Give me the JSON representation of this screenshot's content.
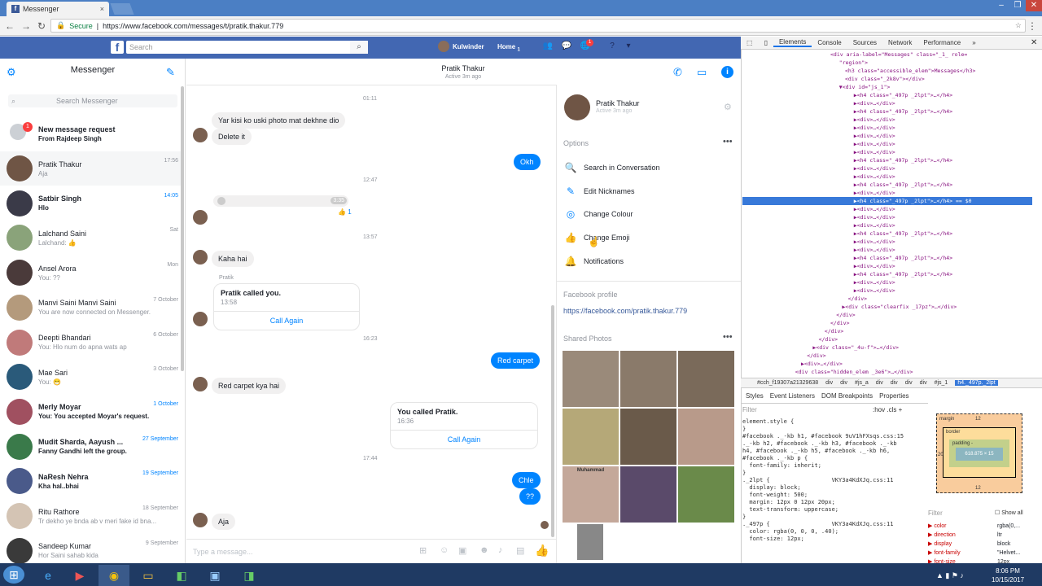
{
  "browser": {
    "tab_title": "Messenger",
    "tab_close": "×",
    "secure_label": "Secure",
    "url": "https://www.facebook.com/messages/t/pratik.thakur.779",
    "window_buttons": [
      "–",
      "❐",
      "✕"
    ]
  },
  "fb_bar": {
    "logo": "f",
    "search_placeholder": "Search",
    "user_name": "Kulwinder",
    "home_label": "Home",
    "home_count": "1",
    "notif_count": "1"
  },
  "left": {
    "title": "Messenger",
    "search_placeholder": "Search Messenger",
    "new_request": {
      "title": "New message request",
      "from": "From Rajdeep Singh",
      "badge": "1"
    },
    "conversations": [
      {
        "name": "Pratik Thakur",
        "snippet": "Aja",
        "time": "17:56",
        "unread": false,
        "active": true,
        "color": "#6f5545"
      },
      {
        "name": "Satbir Singh",
        "snippet": "Hlo",
        "time": "14:05",
        "unread": true,
        "active": false,
        "color": "#3a3a48"
      },
      {
        "name": "Lalchand Saini",
        "snippet": "Lalchand: 👍",
        "time": "Sat",
        "unread": false,
        "active": false,
        "color": "#8aa37a"
      },
      {
        "name": "Ansel Arora",
        "snippet": "You: ??",
        "time": "Mon",
        "unread": false,
        "active": false,
        "color": "#4a3a3a"
      },
      {
        "name": "Manvi Saini Manvi Saini",
        "snippet": "You are now connected on Messenger.",
        "time": "7 October",
        "unread": false,
        "active": false,
        "color": "#b49a7c"
      },
      {
        "name": "Deepti Bhandari",
        "snippet": "You: Hlo num do apna wats ap",
        "time": "6 October",
        "unread": false,
        "active": false,
        "color": "#c07a7a"
      },
      {
        "name": "Mae Sari",
        "snippet": "You: 😁",
        "time": "3 October",
        "unread": false,
        "active": false,
        "color": "#2a5a7a"
      },
      {
        "name": "Merly Moyar",
        "snippet": "You: You accepted Moyar's request.",
        "time": "1 October",
        "unread": true,
        "active": false,
        "color": "#a05060"
      },
      {
        "name": "Mudit Sharda, Aayush ...",
        "snippet": "Fanny Gandhi left the group.",
        "time": "27 September",
        "unread": true,
        "active": false,
        "color": "#3a7a4a"
      },
      {
        "name": "NaResh Nehra",
        "snippet": "Kha hal..bhai",
        "time": "19 September",
        "unread": true,
        "active": false,
        "color": "#4a5a8a"
      },
      {
        "name": "Ritu Rathore",
        "snippet": "Tr dekho ye bnda ab v meri fake id bna...",
        "time": "18 September",
        "unread": false,
        "active": false,
        "color": "#d4c4b4"
      },
      {
        "name": "Sandeep Kumar",
        "snippet": "Hor Saini sahab kida",
        "time": "9 September",
        "unread": false,
        "active": false,
        "color": "#3a3a3a"
      }
    ]
  },
  "chat": {
    "name": "Pratik Thakur",
    "status": "Active 3m ago",
    "messages": {
      "ts1": "01:11",
      "m1": "Yar kisi ko uski photo mat dekhne dio",
      "m2": "Delete it",
      "m3": "Okh",
      "ts2": "12:47",
      "audio_time": "3:35",
      "audio_likes": "1",
      "ts3": "13:57",
      "m4": "Kaha hai",
      "call_sender": "Pratik",
      "call1_title": "Pratik called you.",
      "call1_time": "13:58",
      "call_again": "Call Again",
      "ts4": "16:23",
      "m5": "Red carpet",
      "m6": "Red carpet kya hai",
      "call2_title": "You called Pratik.",
      "call2_time": "16:36",
      "ts5": "17:44",
      "m7": "Chle",
      "m8": "??",
      "m9": "Aja"
    },
    "compose_placeholder": "Type a message..."
  },
  "info": {
    "name": "Pratik Thakur",
    "status": "Active 3m ago",
    "options_label": "Options",
    "options": [
      {
        "label": "Search in Conversation",
        "icon": "🔍"
      },
      {
        "label": "Edit Nicknames",
        "icon": "✎"
      },
      {
        "label": "Change Colour",
        "icon": "◎"
      },
      {
        "label": "Change Emoji",
        "icon": "👍"
      },
      {
        "label": "Notifications",
        "icon": "🔔"
      }
    ],
    "profile_label": "Facebook profile",
    "profile_link": "https://facebook.com/pratik.thakur.779",
    "photos_label": "Shared Photos",
    "photo_caption": "Muhammad",
    "photo_colors": [
      "#9a8a7a",
      "#8a7a6a",
      "#7a6a5a",
      "#b5a878",
      "#6a5a4a",
      "#b89a8a",
      "#c4a89a",
      "#5a4a6a",
      "#6a8a4a",
      "#888888"
    ]
  },
  "devtools": {
    "tabs": [
      "Elements",
      "Console",
      "Sources",
      "Network",
      "Performance",
      "»"
    ],
    "dom_lines": [
      "<div aria-label=\"Messages\" class=\"_1_ role=",
      "\"region\">",
      "<h3 class=\"accessible_elem\">Messages</h3>",
      "<div class=\"_2k8v\"></div>",
      "▼<div id=\"js_1\">",
      "▶<h4 class=\"_497p _2lpt\">…</h4>",
      "▶<div>…</div>",
      "▶<h4 class=\"_497p _2lpt\">…</h4>",
      "▶<div>…</div>",
      "▶<div>…</div>",
      "▶<div>…</div>",
      "▶<div>…</div>",
      "▶<div>…</div>",
      "▶<h4 class=\"_497p _2lpt\">…</h4>",
      "▶<div>…</div>",
      "▶<div>…</div>",
      "▶<h4 class=\"_497p _2lpt\">…</h4>",
      "▶<div>…</div>",
      "▶<h4 class=\"_497p _2lpt\">…</h4> == $0",
      "▶<div>…</div>",
      "▶<div>…</div>",
      "▶<div>…</div>",
      "▶<h4 class=\"_497p _2lpt\">…</h4>",
      "▶<div>…</div>",
      "▶<div>…</div>",
      "▶<h4 class=\"_497p _2lpt\">…</h4>",
      "▶<div>…</div>",
      "▶<h4 class=\"_497p _2lpt\">…</h4>",
      "▶<div>…</div>",
      "▶<div>…</div>",
      "</div>",
      "▶<div class=\"clearfix _17pz\">…</div>",
      "</div>",
      "</div>",
      "</div>",
      "</div>",
      "▶<div class=\"_4u-f\">…</div>",
      "</div>",
      "▶<div>…</div>",
      "<div class=\"hidden_elem _3e6\">…</div>"
    ],
    "crumbs": [
      "#cch_f19307a21329638",
      "div",
      "div",
      "#js_a",
      "div",
      "div",
      "div",
      "div",
      "#js_1",
      "h4._497p._2lpt"
    ],
    "subtabs": [
      "Styles",
      "Event Listeners",
      "DOM Breakpoints",
      "Properties"
    ],
    "filter": "Filter",
    "hov": ":hov  .cls  +",
    "styles_text": "element.style {\n}\n#facebook ._-kb h1, #facebook 9uV1hFXsqs.css:15\n._-kb h2, #facebook ._-kb h3, #facebook ._-kb\nh4, #facebook ._-kb h5, #facebook ._-kb h6,\n#facebook ._-kb p {\n  font-family: inherit;\n}\n._2lpt {                  VKY3a4KdXJq.css:11\n  display: block;\n  font-weight: 500;\n  margin: 12px 0 12px 20px;\n  text-transform: uppercase;\n}\n._497p {                  VKY3a4KdXJq.css:11\n  color: rgba(0, 0, 0, .40);\n  font-size: 12px;",
    "box": {
      "margin": "margin",
      "margin_val": "12",
      "border": "border",
      "padding": "padding -",
      "content": "618.875 × 15",
      "left": "20",
      "bottom": "12"
    },
    "comp_filter": "Filter",
    "show_all": "Show all",
    "computed": [
      {
        "k": "color",
        "v": "rgba(0,..."
      },
      {
        "k": "direction",
        "v": "ltr"
      },
      {
        "k": "display",
        "v": "block"
      },
      {
        "k": "font-family",
        "v": "\"Helvet..."
      },
      {
        "k": "font-size",
        "v": "12px"
      }
    ]
  },
  "taskbar": {
    "time": "8:06 PM",
    "date": "10/15/2017"
  }
}
